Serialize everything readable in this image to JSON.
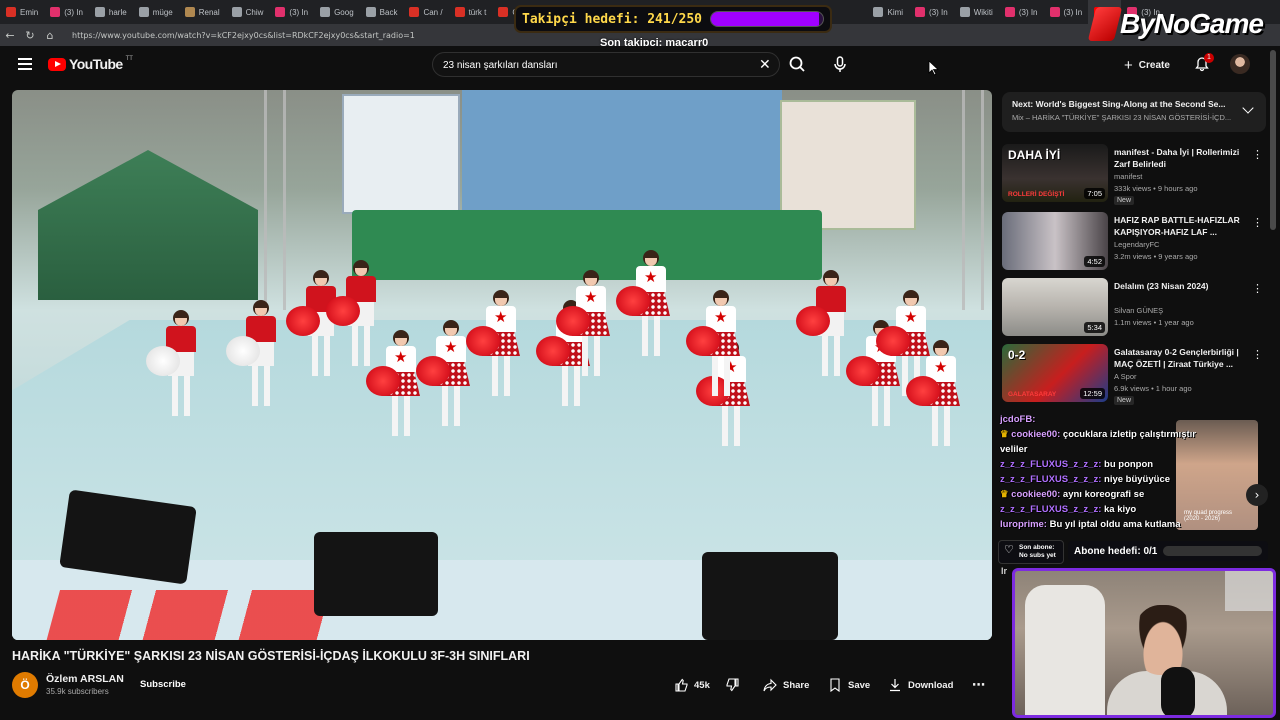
{
  "browser": {
    "tabs": [
      {
        "label": "Emin",
        "color": "#d93025"
      },
      {
        "label": "(3) In",
        "color": "#e1306c"
      },
      {
        "label": "harle",
        "color": "#9aa0a6"
      },
      {
        "label": "müge",
        "color": "#9aa0a6"
      },
      {
        "label": "Renal",
        "color": "#b08850"
      },
      {
        "label": "Chiw",
        "color": "#9aa0a6"
      },
      {
        "label": "(3) In",
        "color": "#e1306c"
      },
      {
        "label": "Goog",
        "color": "#9aa0a6"
      },
      {
        "label": "Back",
        "color": "#9aa0a6"
      },
      {
        "label": "Can /",
        "color": "#d93025"
      },
      {
        "label": "türk t",
        "color": "#d93025"
      },
      {
        "label": "GASI",
        "color": "#d93025"
      },
      {
        "label": "Kimi",
        "color": "#9aa0a6"
      },
      {
        "label": "(3) In",
        "color": "#e1306c"
      },
      {
        "label": "Wikiti",
        "color": "#9aa0a6"
      },
      {
        "label": "(3) In",
        "color": "#e1306c"
      },
      {
        "label": "(3) In",
        "color": "#e1306c"
      },
      {
        "label": "(1",
        "color": "#ff0000"
      },
      {
        "label": "(3) In",
        "color": "#e1306c"
      }
    ],
    "url": "https://www.youtube.com/watch?v=kCF2ejxy0cs&list=RDkCF2ejxy0cs&start_radio=1"
  },
  "overlay": {
    "follower_goal_text": "Takipçi hedefi: 241/250",
    "follower_goal_fraction": 0.964,
    "last_follower": "Son takipçi: macarr0",
    "brand_name": "ByNoGame",
    "sub_last_line1": "Son abone:",
    "sub_last_line2": "No subs yet",
    "sub_goal_text": "Abone hedefi: 0/1",
    "sub_goal_fraction": 0,
    "clip_text": "Ir",
    "cam_caption_1": "my quad progress",
    "cam_caption_2": "(2020 - 2026)"
  },
  "youtube": {
    "logo_text": "YouTube",
    "logo_country": "TT",
    "search_value": "23 nisan şarkıları dansları",
    "create_label": "Create",
    "notif_count": "1",
    "video": {
      "title": "HARİKA \"TÜRKİYE\" ŞARKISI 23 NİSAN GÖSTERİSİ-İÇDAŞ İLKOKULU 3F-3H SINIFLARI",
      "channel_initial": "Ö",
      "channel_name": "Özlem ARSLAN",
      "channel_subs": "35.9k subscribers",
      "subscribe_label": "Subscribe",
      "like_count": "45k",
      "share_label": "Share",
      "save_label": "Save",
      "download_label": "Download"
    },
    "next": {
      "line1": "Next: World's Biggest Sing-Along at the Second Se...",
      "line2": "Mix – HARİKA \"TÜRKİYE\" ŞARKISI 23 NİSAN GÖSTERİSİ-İÇD..."
    },
    "recommendations": [
      {
        "title": "manifest - Daha İyi | Rollerimizi Zarf Belirledi",
        "channel": "manifest",
        "stats": "333k views • 9 hours ago",
        "badge": "New",
        "duration": "7:05",
        "thumb_text": "DAHA İYİ",
        "thumb_sub": "ROLLERİ DEĞİŞTİ"
      },
      {
        "title": "HAFIZ RAP BATTLE-HAFIZLAR KAPIŞIYOR-HAFIZ LAF ...",
        "channel": "LegendaryFC",
        "stats": "3.2m views • 9 years ago",
        "badge": "",
        "duration": "4:52",
        "thumb_text": "",
        "thumb_sub": ""
      },
      {
        "title": "Delalım (23 Nisan 2024)",
        "channel": "Silvan GÜNEŞ",
        "stats": "1.1m views • 1 year ago",
        "badge": "",
        "duration": "5:34",
        "thumb_text": "",
        "thumb_sub": ""
      },
      {
        "title": "Galatasaray 0-2 Gençlerbirliği | MAÇ ÖZETİ | Ziraat Türkiye ...",
        "channel": "A Spor",
        "stats": "6.9k views • 1 hour ago",
        "badge": "New",
        "duration": "12:59",
        "thumb_text": "0-2",
        "thumb_sub": "GALATASARAY"
      }
    ]
  },
  "chat": [
    {
      "user": "jcdoFB:",
      "text": "",
      "crown": false,
      "user_color": "#d8a0ff"
    },
    {
      "user": "cookiee00:",
      "text": "çocuklara izletip çalıştırmıştır",
      "crown": true,
      "user_color": "#d8a0ff"
    },
    {
      "user": "",
      "text": "veliler",
      "crown": false,
      "user_color": "#d8a0ff"
    },
    {
      "user": "z_z_z_FLUXUS_z_z_z:",
      "text": "bu ponpon",
      "crown": false,
      "user_color": "#b070ff"
    },
    {
      "user": "z_z_z_FLUXUS_z_z_z:",
      "text": "niye büyüyüce",
      "crown": false,
      "user_color": "#b070ff"
    },
    {
      "user": "cookiee00:",
      "text": "aynı koreografi se",
      "crown": true,
      "user_color": "#d8a0ff"
    },
    {
      "user": "z_z_z_FLUXUS_z_z_z:",
      "text": "ka kiyo",
      "crown": false,
      "user_color": "#b070ff"
    },
    {
      "user": "luroprime:",
      "text": "Bu yıl iptal oldu ama kutlama",
      "crown": false,
      "user_color": "#d8a0ff"
    }
  ]
}
